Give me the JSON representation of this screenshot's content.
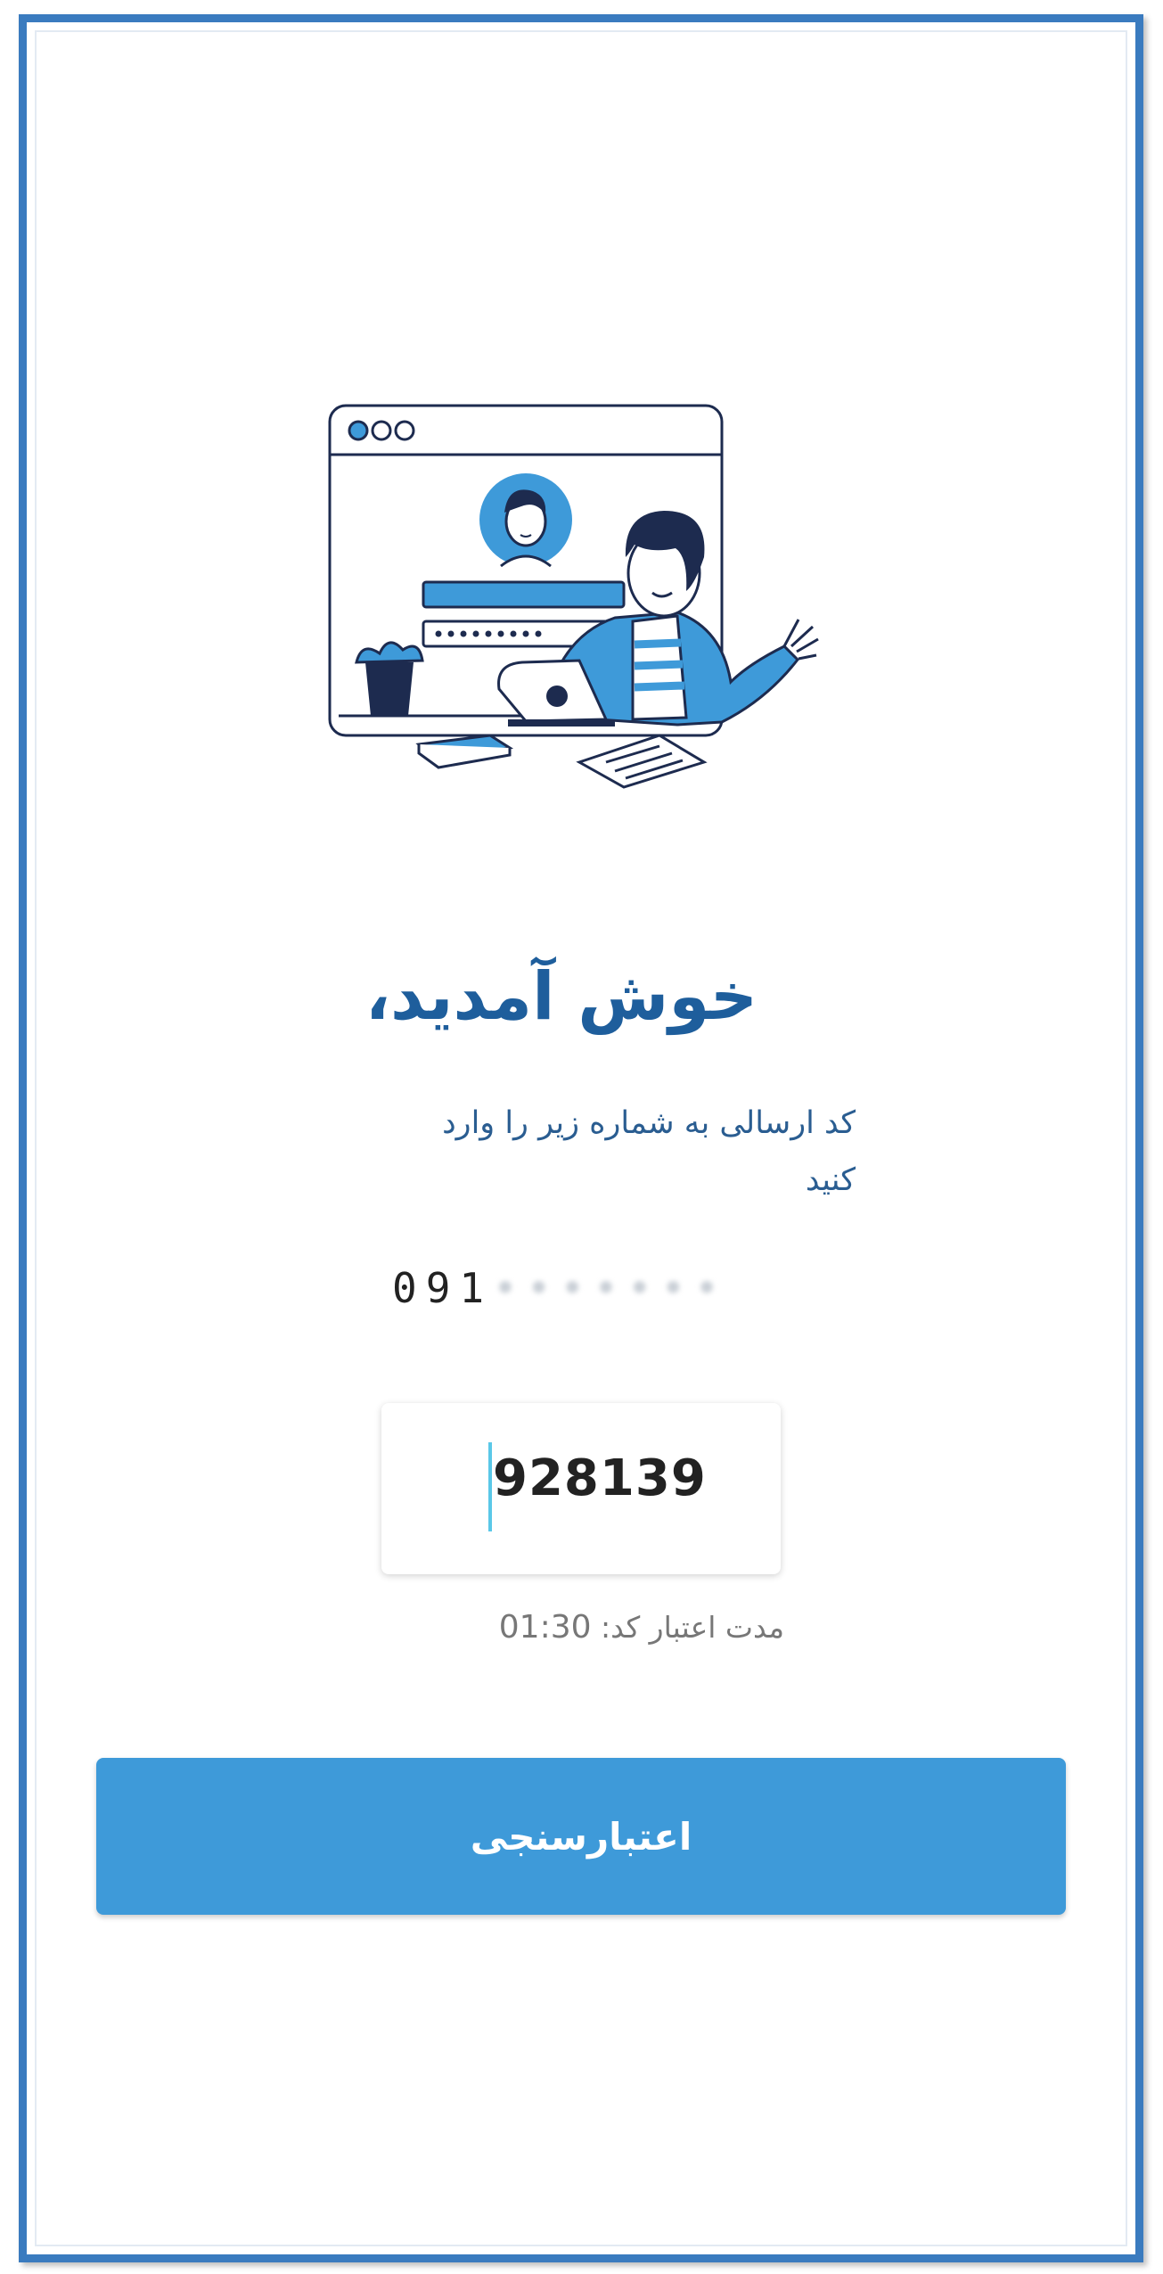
{
  "welcome": {
    "title": "خوش آمدید،",
    "subtitle": "کد ارسالی به شماره زیر را وارد کنید"
  },
  "phone": {
    "visible_prefix": "091",
    "masked_suffix": "•••••••"
  },
  "code_input": {
    "value": "928139"
  },
  "timer": {
    "label": "مدت اعتبار کد:",
    "value": "01:30"
  },
  "verify_button": {
    "label": "اعتبارسنجی"
  },
  "colors": {
    "accent": "#3e9ad9",
    "title": "#1e5e9c",
    "frame": "#3a7bbf"
  }
}
